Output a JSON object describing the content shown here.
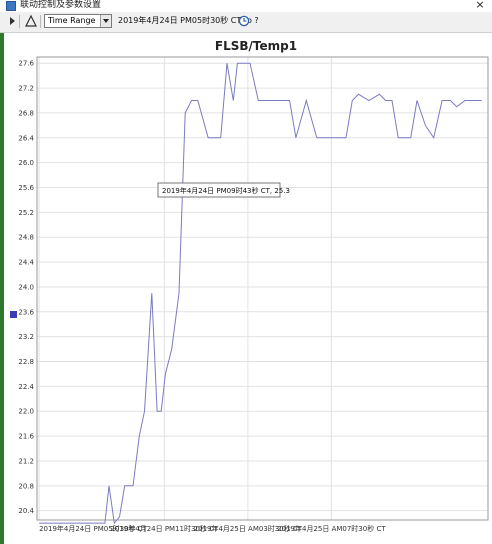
{
  "window": {
    "title": "联动控制及参数设置",
    "close_label": "×"
  },
  "toolbar": {
    "range_mode": "Time Range",
    "range_text": "2019年4月24日 PM05时30秒 CT  to  ?"
  },
  "icons": {
    "play": "play-icon",
    "delta": "delta-icon",
    "clock": "clock-icon",
    "close": "close-icon"
  },
  "colors": {
    "series": "#7b7bc2",
    "legend": "#3c3cb4",
    "grid": "#e2e2e2"
  },
  "tooltip": {
    "text": "2019年4月24日 PM09时43秒 CT, 25.3"
  },
  "chart_data": {
    "type": "line",
    "title": "FLSB/Temp1",
    "xlabel": "",
    "ylabel": "",
    "y_ticks": [
      "20.4",
      "20.8",
      "21.2",
      "21.6",
      "22.0",
      "22.4",
      "22.8",
      "23.2",
      "23.6",
      "24.0",
      "24.4",
      "24.8",
      "25.2",
      "25.6",
      "26.0",
      "26.4",
      "26.8",
      "27.2",
      "27.6"
    ],
    "x_ticks": [
      "2019年4月24日 PM05时30秒 CT",
      "2019年4月24日 PM11时30秒 CT",
      "2019年4月25日 AM03时30秒 CT",
      "2019年4月25日 AM07时30秒 CT"
    ],
    "ylim": [
      20.25,
      27.7
    ],
    "x_hours": [
      0,
      0.45,
      0.9,
      1.35,
      1.8,
      2.25,
      2.7,
      3.15,
      3.35,
      3.6,
      3.85,
      4.1,
      4.5,
      4.8,
      5.05,
      5.4,
      5.65,
      5.85,
      6.05,
      6.35,
      6.7,
      7.0,
      7.3,
      7.6,
      8.1,
      8.4,
      8.7,
      9.0,
      9.3,
      9.5,
      9.8,
      10.1,
      10.5,
      11.2,
      11.55,
      11.75,
      12.0,
      12.3,
      12.8,
      13.3,
      13.55,
      13.8,
      14.1,
      14.4,
      14.7,
      15.0,
      15.3,
      15.8,
      16.3,
      16.6,
      16.9,
      17.2,
      17.5,
      17.8,
      18.1,
      18.5
    ],
    "y_values": [
      20.2,
      20.2,
      20.2,
      20.2,
      20.2,
      20.2,
      20.2,
      20.2,
      20.8,
      20.2,
      20.3,
      20.8,
      20.8,
      21.6,
      22.0,
      23.9,
      22.0,
      22.0,
      22.6,
      23.0,
      23.9,
      26.8,
      27.0,
      27.0,
      26.4,
      26.4,
      26.4,
      27.6,
      27.0,
      27.6,
      27.6,
      27.6,
      27.0,
      27.0,
      27.0,
      27.0,
      27.0,
      26.4,
      27.0,
      26.4,
      26.4,
      26.4,
      26.4,
      26.4,
      26.4,
      27.0,
      27.1,
      27.0,
      27.1,
      27.0,
      27.0,
      26.4,
      26.4,
      26.4,
      27.0,
      26.6
    ],
    "x_tail_hours": [
      18.9,
      19.3,
      19.7,
      20.0,
      20.4,
      20.8,
      21.2
    ],
    "y_tail_values": [
      26.4,
      27.0,
      27.0,
      26.9,
      27.0,
      27.0,
      27.0
    ],
    "xlim_hours": [
      -0.1,
      21.5
    ],
    "x_tick_hours": [
      0,
      6,
      10,
      14
    ],
    "grid": true,
    "legend": "left, square swatch, no text"
  }
}
